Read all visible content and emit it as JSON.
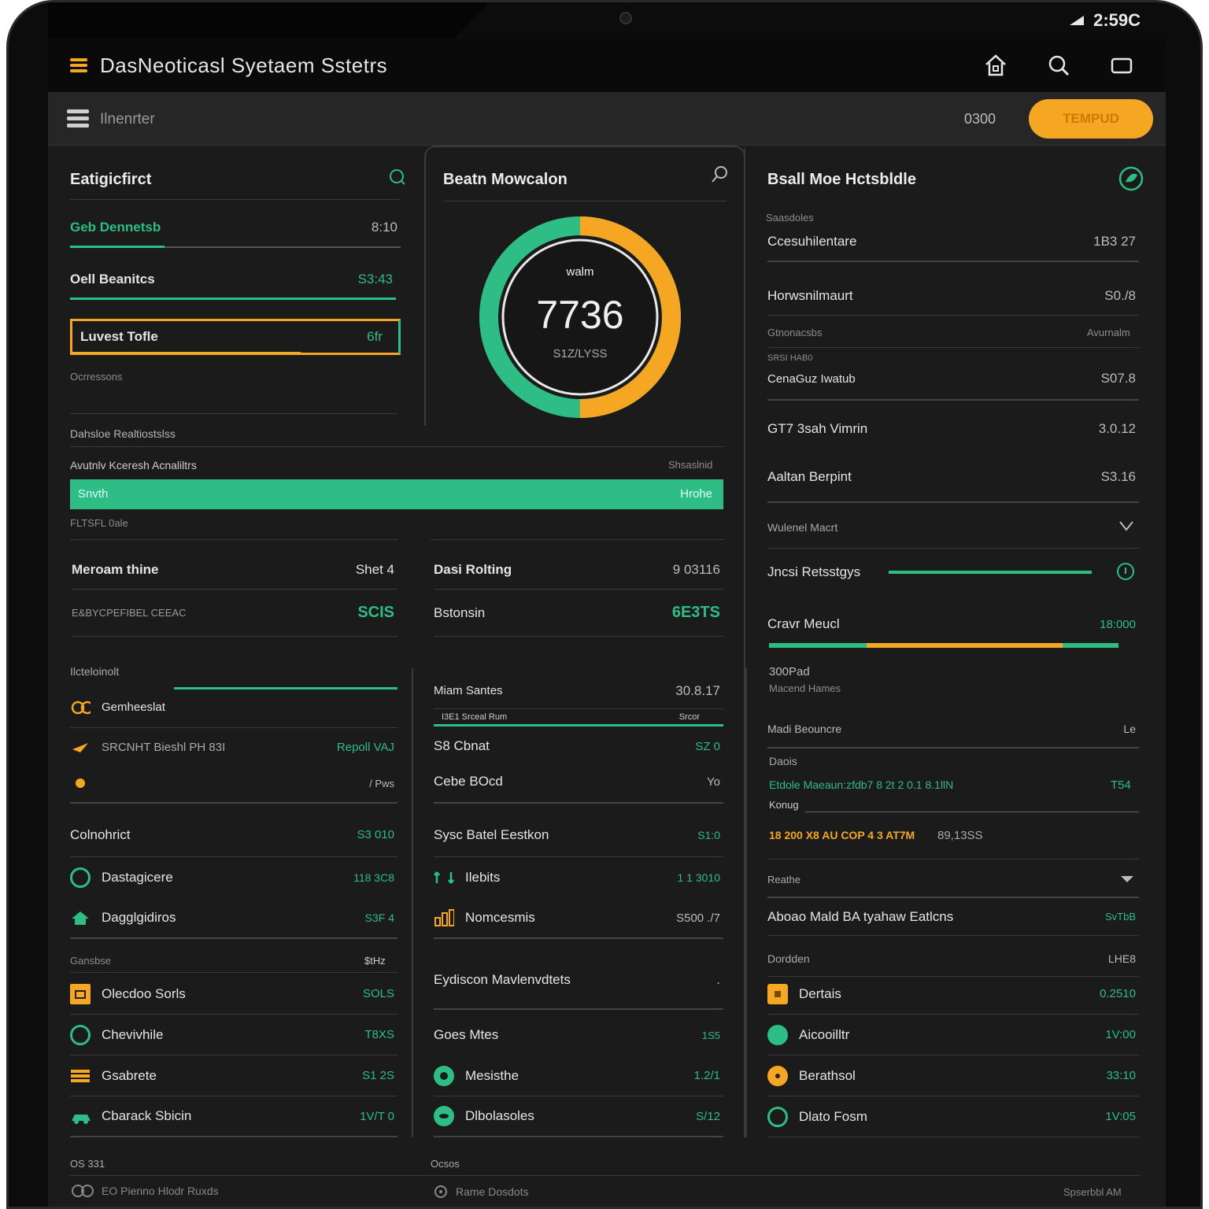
{
  "device": {
    "status_time": "2:59C"
  },
  "app": {
    "title": "DasNeoticasl Syetaem Sstetrs"
  },
  "toolbar": {
    "label": "Ilnenrter",
    "time": "0300",
    "button": "TEMPUD"
  },
  "colors": {
    "accent_green": "#2dbd85",
    "accent_orange": "#f5a623",
    "background": "#1b1b1b"
  },
  "left": {
    "title": "Eatigicfirct",
    "rows": [
      {
        "label": "Geb Dennetsb",
        "value": "8:10"
      },
      {
        "label": "Oell Beanitcs",
        "value": "S3:43"
      },
      {
        "label": "Luvest Tofle",
        "value": "6fr"
      }
    ],
    "caption": "Ocrressons",
    "section_label": "Dahsloe Realtiostslss"
  },
  "middle": {
    "title": "Beatn Mowcalon",
    "gauge": {
      "top": "walm",
      "value": "7736",
      "sub": "S1Z/LYSS",
      "fraction": 0.5
    }
  },
  "progress": {
    "label": "Avutnlv Kceresh Acnaliltrs",
    "right_label": "Shsaslnid",
    "inner_left": "Snvth",
    "inner_right": "Hrohe",
    "fraction": 1.0,
    "caption": "FLTSFL 0ale"
  },
  "right": {
    "title": "Bsall Moe Hctsbldle",
    "sub": "Saasdoles",
    "rows": [
      {
        "label": "Ccesuhilentare",
        "value": "1B3 27"
      },
      {
        "label": "Horwsnilmaurt",
        "value": "S0./8"
      }
    ],
    "line1_left": "Gtnonacsbs",
    "line1_right": "Avurnalm",
    "line2": "SRSI HAB0",
    "rows2": [
      {
        "label": "CenaGuz Iwatub",
        "value": "S07.8"
      },
      {
        "label": "GT7 3sah Vimrin",
        "value": "3.0.12"
      },
      {
        "label": "Aaltan Berpint",
        "value": "S3.16"
      }
    ],
    "dropdown": "Wulenel Macrt",
    "jresi": "Jncsi Retsstgys",
    "cravy": {
      "label": "Cravr Meucl",
      "value": "18:000",
      "sub1": "300Pad",
      "sub2": "Macend Hames"
    },
    "mediu": {
      "label": "Madi Beouncre",
      "value": "Le"
    },
    "dacis": "Daois",
    "mixed_line": "Etdole Maeaun:zfdb7 8 2t 2 0.1 8.1llN",
    "mixed_value": "T54",
    "kouug": "Konug",
    "orange_line": "18 200 X8 AU COP 4 3 AT7M",
    "orange_value": "89,13SS",
    "reathe": "Reathe",
    "row_aboa": {
      "label": "Aboao Mald BA tyahaw Eatlcns",
      "value": "SvTbB"
    },
    "dorddan": {
      "label": "Dordden",
      "value": "LHE8"
    },
    "list": [
      {
        "icon": "tag-icon",
        "label": "Dertais",
        "value": "0.2510"
      },
      {
        "icon": "leaf-icon",
        "label": "Aicooilltr",
        "value": "1V:00"
      },
      {
        "icon": "coin-icon",
        "label": "Berathsol",
        "value": "33:10"
      },
      {
        "icon": "refresh-icon",
        "label": "Dlato Fosm",
        "value": "1V:05"
      }
    ]
  },
  "midsec": {
    "left": [
      {
        "label": "Meroam thine",
        "value": "Shet 4"
      },
      {
        "label": "E&BYCPEFIBEL CEEAC",
        "value": "SCIS"
      }
    ],
    "right": [
      {
        "label": "Dasi Rolting",
        "value": "9 03116"
      },
      {
        "label": "Bstonsin",
        "value": "6E3TS"
      }
    ]
  },
  "lower_left": {
    "caption": "Ilcteloinolt",
    "rows": [
      {
        "icon": "link-icon",
        "label": "Gemheeslat",
        "value": ""
      },
      {
        "icon": "plane-icon",
        "label": "SRCNHT  Bieshl PH 83I",
        "value": "Repoll VAJ"
      },
      {
        "icon": "dot-icon",
        "label": "",
        "value": "/ Pws"
      }
    ],
    "colnohrict": {
      "label": "Colnohrict",
      "value": "S3 010"
    },
    "list": [
      {
        "icon": "refresh-icon",
        "label": "Dastagicere",
        "value": "118 3C8"
      },
      {
        "icon": "home-icon",
        "label": "Dagglgidiros",
        "value": "S3F 4"
      }
    ],
    "sub": {
      "label": "Gansbse",
      "value": "$tHz"
    },
    "list2": [
      {
        "icon": "calendar-icon",
        "label": "Olecdoo Sorls",
        "value": "SOLS"
      },
      {
        "icon": "leaf-icon",
        "label": "Chevivhile",
        "value": "T8XS"
      },
      {
        "icon": "stack-icon",
        "label": "Gsabrete",
        "value": "S1 2S"
      },
      {
        "icon": "car-icon",
        "label": "Cbarack Sbicin",
        "value": "1V/T 0"
      }
    ]
  },
  "lower_mid": {
    "header": {
      "label": "Miam Santes",
      "value": "30.8.17"
    },
    "subbar": {
      "left": "I3E1 Srceal Rum",
      "right": "Srcor"
    },
    "rows": [
      {
        "label": "S8 Cbnat",
        "value": "SZ 0"
      },
      {
        "label": "Cebe BOcd",
        "value": "Yo"
      }
    ],
    "sysb": {
      "label": "Sysc Batel Eestkon",
      "value": "S1:0"
    },
    "list": [
      {
        "icon": "swap-icon",
        "label": "Ilebits",
        "value": "1 1 3010"
      },
      {
        "icon": "chart-icon",
        "label": "Nomcesmis",
        "value": "S500 ./7"
      }
    ],
    "eydi": {
      "label": "Eydiscon Mavlenvdtets",
      "value": "."
    },
    "goes": {
      "label": "Goes Mtes",
      "value": "1S5"
    },
    "list2": [
      {
        "icon": "globe-icon",
        "label": "Mesisthe",
        "value": "1.2/1"
      },
      {
        "icon": "leaf-icon",
        "label": "Dlbolasoles",
        "value": "S/12"
      }
    ]
  },
  "footer": {
    "left_caption": "OS 331",
    "left": "EO Pienno Hlodr Ruxds",
    "mid_caption": "Ocsos",
    "mid": "Rame Dosdots",
    "right": "Spserbbl AM"
  }
}
